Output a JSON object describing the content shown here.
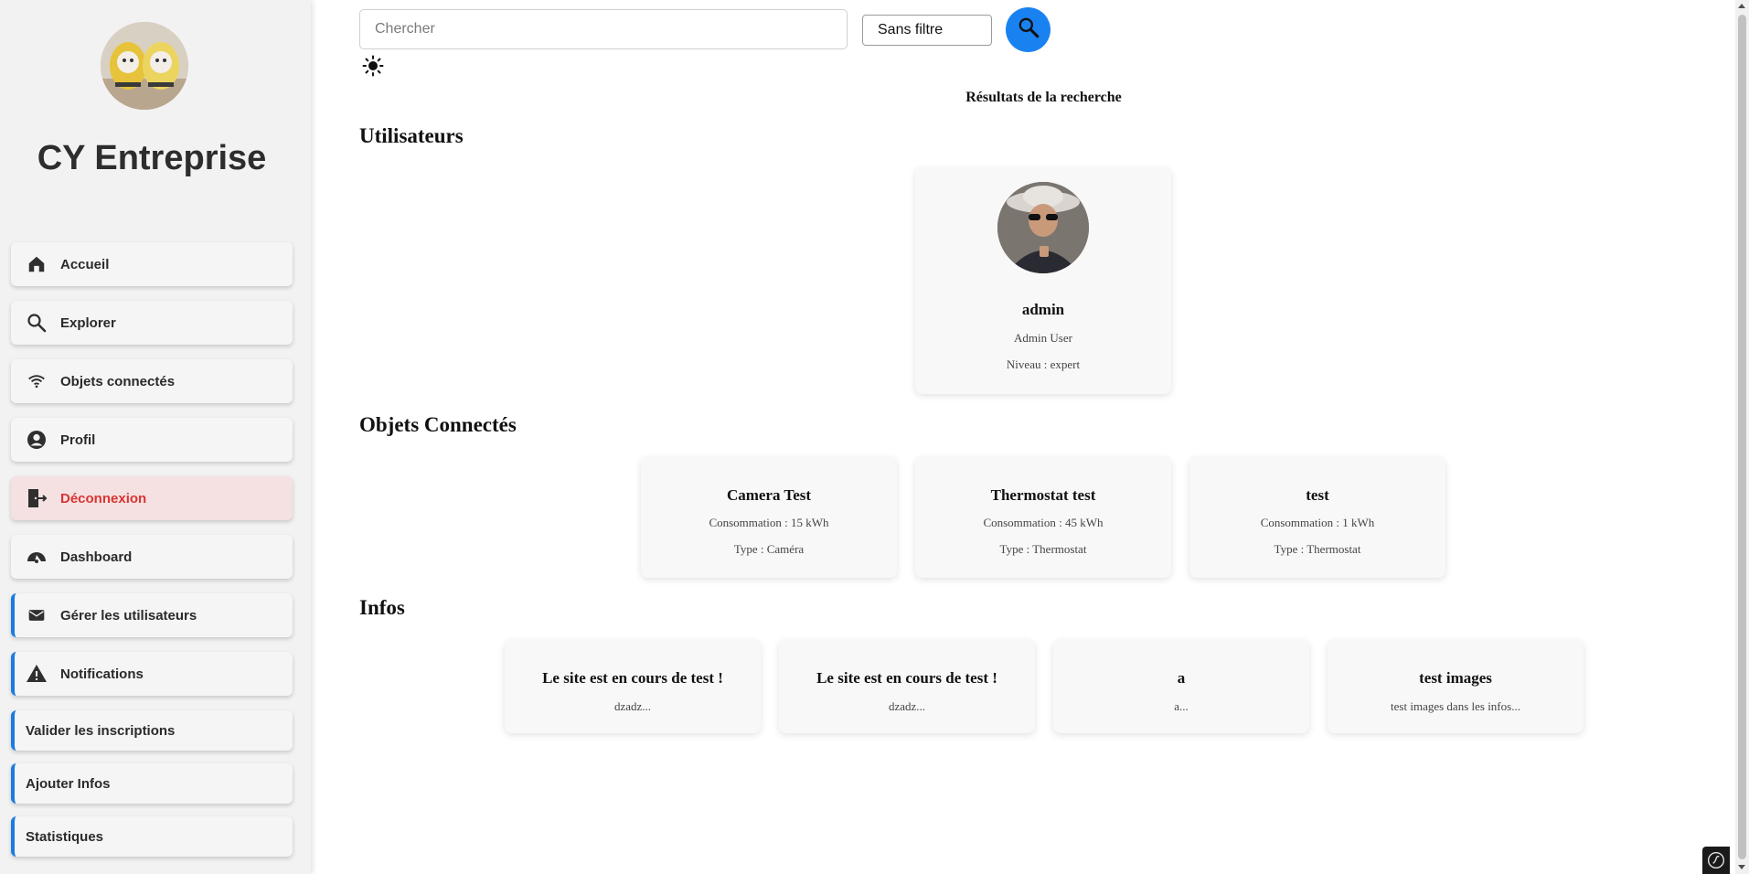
{
  "sidebar": {
    "brand": "CY Entreprise",
    "items": [
      {
        "label": "Accueil",
        "icon": "home-icon"
      },
      {
        "label": "Explorer",
        "icon": "search-icon"
      },
      {
        "label": "Objets connectés",
        "icon": "wifi-icon"
      },
      {
        "label": "Profil",
        "icon": "user-circle-icon"
      },
      {
        "label": "Déconnexion",
        "icon": "logout-icon"
      },
      {
        "label": "Dashboard",
        "icon": "gauge-icon"
      },
      {
        "label": "Gérer les utilisateurs",
        "icon": "mail-icon"
      },
      {
        "label": "Notifications",
        "icon": "warning-icon"
      },
      {
        "label": "Valider les inscriptions"
      },
      {
        "label": "Ajouter Infos"
      },
      {
        "label": "Statistiques"
      }
    ]
  },
  "search": {
    "placeholder": "Chercher",
    "filter_value": "Sans filtre"
  },
  "results": {
    "title": "Résultats de la recherche",
    "users_title": "Utilisateurs",
    "objects_title": "Objets Connectés",
    "infos_title": "Infos",
    "users": [
      {
        "username": "admin",
        "fullname": "Admin User",
        "level": "Niveau : expert"
      }
    ],
    "objects": [
      {
        "name": "Camera Test",
        "consumption": "Consommation : 15 kWh",
        "type": "Type : Caméra"
      },
      {
        "name": "Thermostat test",
        "consumption": "Consommation : 45 kWh",
        "type": "Type : Thermostat"
      },
      {
        "name": "test",
        "consumption": "Consommation : 1 kWh",
        "type": "Type : Thermostat"
      }
    ],
    "infos": [
      {
        "title": "Le site est en cours de test !",
        "excerpt": "dzadz..."
      },
      {
        "title": "Le site est en cours de test !",
        "excerpt": "dzadz..."
      },
      {
        "title": "a",
        "excerpt": "a..."
      },
      {
        "title": "test images",
        "excerpt": "test images dans les infos..."
      }
    ]
  },
  "colors": {
    "accent": "#1a82f0",
    "danger": "#d93434",
    "sidebar_bg": "#f2f2f2"
  }
}
